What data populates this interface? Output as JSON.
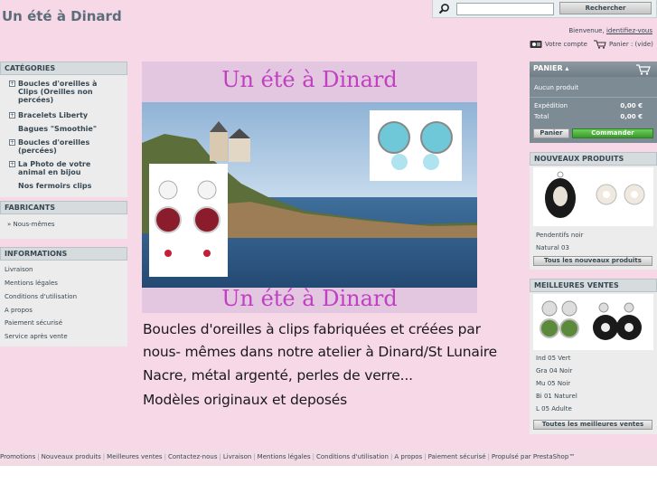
{
  "header": {
    "shop_name": "Un été à Dinard",
    "search_button": "Rechercher",
    "search_value": "",
    "welcome": "Bienvenue,",
    "login_link": "identifiez-vous",
    "account": "Votre compte",
    "cart": "Panier : (vide)"
  },
  "categories": {
    "title": "CATÉGORIES",
    "items": [
      {
        "label": "Boucles d'oreilles à Clips (Oreilles non percées)",
        "expandable": "⊞"
      },
      {
        "label": "Bracelets Liberty",
        "expandable": "⊞"
      },
      {
        "label": "Bagues \"Smoothie\"",
        "expandable": ""
      },
      {
        "label": "Boucles d'oreilles (percées)",
        "expandable": "⊞"
      },
      {
        "label": "La Photo de votre animal en bijou",
        "expandable": "⊞"
      },
      {
        "label": "Nos fermoirs clips",
        "expandable": ""
      }
    ]
  },
  "manufacturers": {
    "title": "FABRICANTS",
    "items": [
      "Nous-mêmes"
    ]
  },
  "information": {
    "title": "INFORMATIONS",
    "items": [
      "Livraison",
      "Mentions légales",
      "Conditions d'utilisation",
      "A propos",
      "Paiement sécurisé",
      "Service après vente"
    ]
  },
  "banner": {
    "title_top": "Un été à Dinard",
    "title_bottom": "Un été à Dinard"
  },
  "description": [
    "Boucles d'oreilles à clips fabriquées et créées par",
    "nous- mêmes dans notre atelier à Dinard/St Lunaire",
    "Nacre, métal argenté, perles de verre...",
    "Modèles originaux et deposés"
  ],
  "cart_block": {
    "title": "PANIER",
    "empty": "Aucun produit",
    "shipping_label": "Expédition",
    "shipping_value": "0,00 €",
    "total_label": "Total",
    "total_value": "0,00 €",
    "cart_button": "Panier",
    "order_button": "Commander"
  },
  "new_products": {
    "title": "NOUVEAUX PRODUITS",
    "items": [
      "Pendentifs noir",
      "Natural 03"
    ],
    "all_button": "Tous les nouveaux produits"
  },
  "best_sales": {
    "title": "MEILLEURES VENTES",
    "items": [
      "Ind 05 Vert",
      "Gra 04 Noir",
      "Mu 05 Noir",
      "Bi 01 Naturel",
      "L 05 Adulte"
    ],
    "all_button": "Toutes les meilleures ventes"
  },
  "footer": {
    "links": [
      "Promotions",
      "Nouveaux produits",
      "Meilleures ventes",
      "Contactez-nous",
      "Livraison",
      "Mentions légales",
      "Conditions d'utilisation",
      "A propos",
      "Paiement sécurisé",
      "Propulsé par PrestaShop™"
    ]
  },
  "colors": {
    "page_bg": "#f7d8e6",
    "block_header": "#d6dbde",
    "cart_bg": "#7d8b94",
    "order_green": "#3a9a2c",
    "banner_title": "#c040c0"
  }
}
